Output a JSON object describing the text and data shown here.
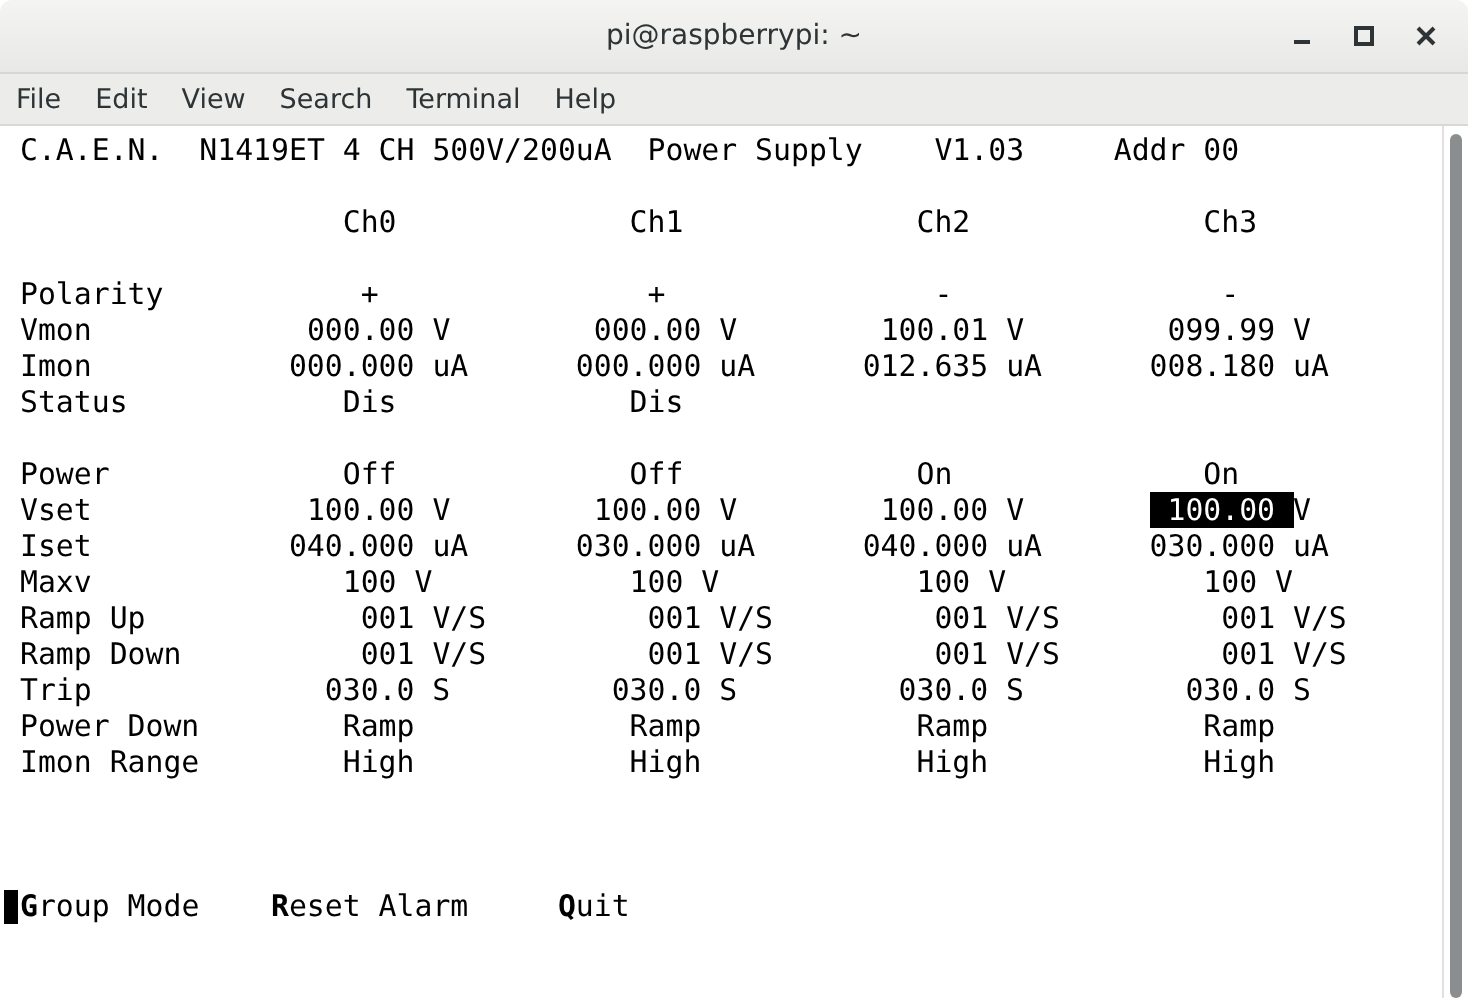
{
  "window": {
    "title": "pi@raspberrypi: ~"
  },
  "menu": [
    "File",
    "Edit",
    "View",
    "Search",
    "Terminal",
    "Help"
  ],
  "terminal": {
    "header": "C.A.E.N.  N1419ET 4 CH 500V/200uA  Power Supply    V1.03     Addr 00",
    "channels": [
      "Ch0",
      "Ch1",
      "Ch2",
      "Ch3"
    ],
    "monitor_rows": [
      {
        "kind": "polarity",
        "label": "Polarity",
        "cells": [
          {
            "text": "+",
            "highlighted": false
          },
          {
            "text": "+",
            "highlighted": false
          },
          {
            "text": "-",
            "highlighted": false
          },
          {
            "text": "-",
            "highlighted": false
          }
        ]
      },
      {
        "kind": "vmon",
        "label": "Vmon",
        "cells": [
          {
            "text": "000.00 V",
            "highlighted": false
          },
          {
            "text": "000.00 V",
            "highlighted": false
          },
          {
            "text": "100.01 V",
            "highlighted": false
          },
          {
            "text": "099.99 V",
            "highlighted": false
          }
        ]
      },
      {
        "kind": "imon",
        "label": "Imon",
        "cells": [
          {
            "text": "000.000 uA",
            "highlighted": false
          },
          {
            "text": "000.000 uA",
            "highlighted": false
          },
          {
            "text": "012.635 uA",
            "highlighted": false
          },
          {
            "text": "008.180 uA",
            "highlighted": false
          }
        ]
      },
      {
        "kind": "status",
        "label": "Status",
        "cells": [
          {
            "text": "Dis",
            "highlighted": false
          },
          {
            "text": "Dis",
            "highlighted": false
          }
        ]
      }
    ],
    "setting_rows": [
      {
        "kind": "power",
        "label": "Power",
        "cells": [
          {
            "text": "Off",
            "highlighted": false
          },
          {
            "text": "Off",
            "highlighted": false
          },
          {
            "text": "On",
            "highlighted": false
          },
          {
            "text": "On",
            "highlighted": false
          }
        ]
      },
      {
        "kind": "vset",
        "label": "Vset",
        "cells": [
          {
            "text": "100.00 V",
            "highlighted": false
          },
          {
            "text": "100.00 V",
            "highlighted": false
          },
          {
            "text": "100.00 V",
            "highlighted": false
          },
          {
            "text": "100.00 V",
            "highlighted": true
          }
        ]
      },
      {
        "kind": "iset",
        "label": "Iset",
        "cells": [
          {
            "text": "040.000 uA",
            "highlighted": false
          },
          {
            "text": "030.000 uA",
            "highlighted": false
          },
          {
            "text": "040.000 uA",
            "highlighted": false
          },
          {
            "text": "030.000 uA",
            "highlighted": false
          }
        ]
      },
      {
        "kind": "maxv",
        "label": "Maxv",
        "cells": [
          {
            "text": "100 V",
            "highlighted": false
          },
          {
            "text": "100 V",
            "highlighted": false
          },
          {
            "text": "100 V",
            "highlighted": false
          },
          {
            "text": "100 V",
            "highlighted": false
          }
        ]
      },
      {
        "kind": "ramp",
        "label": "Ramp Up",
        "cells": [
          {
            "text": "001 V/S",
            "highlighted": false
          },
          {
            "text": "001 V/S",
            "highlighted": false
          },
          {
            "text": "001 V/S",
            "highlighted": false
          },
          {
            "text": "001 V/S",
            "highlighted": false
          }
        ]
      },
      {
        "kind": "ramp",
        "label": "Ramp Down",
        "cells": [
          {
            "text": "001 V/S",
            "highlighted": false
          },
          {
            "text": "001 V/S",
            "highlighted": false
          },
          {
            "text": "001 V/S",
            "highlighted": false
          },
          {
            "text": "001 V/S",
            "highlighted": false
          }
        ]
      },
      {
        "kind": "trip",
        "label": "Trip",
        "cells": [
          {
            "text": "030.0 S",
            "highlighted": false
          },
          {
            "text": "030.0 S",
            "highlighted": false
          },
          {
            "text": "030.0 S",
            "highlighted": false
          },
          {
            "text": "030.0 S",
            "highlighted": false
          }
        ]
      },
      {
        "kind": "power_down",
        "label": "Power Down",
        "cells": [
          {
            "text": "Ramp",
            "highlighted": false
          },
          {
            "text": "Ramp",
            "highlighted": false
          },
          {
            "text": "Ramp",
            "highlighted": false
          },
          {
            "text": "Ramp",
            "highlighted": false
          }
        ]
      },
      {
        "kind": "imon_range",
        "label": "Imon Range",
        "cells": [
          {
            "text": "High",
            "highlighted": false
          },
          {
            "text": "High",
            "highlighted": false
          },
          {
            "text": "High",
            "highlighted": false
          },
          {
            "text": "High",
            "highlighted": false
          }
        ]
      }
    ],
    "commands": [
      "**G**roup Mode",
      "**R**eset Alarm",
      "**Q**uit"
    ]
  }
}
